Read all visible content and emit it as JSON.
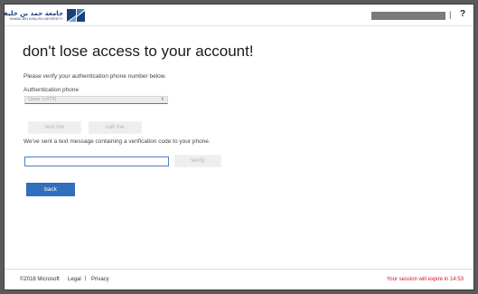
{
  "header": {
    "logo": {
      "arabic_name": "جامعة حمد بن خليفة",
      "english_name": "HAMAD BIN KHALIFA UNIVERSITY",
      "brand_color": "#1b3f7a"
    },
    "separator": "|",
    "help_label": "?"
  },
  "main": {
    "title": "don't lose access to your account!",
    "intro": "Please verify your authentication phone number below.",
    "phone_label": "Authentication phone",
    "phone_select_value": "Qatar (+974)",
    "text_me_label": "text me",
    "call_me_label": "call me",
    "sent_message": "We've sent a text message containing a verification code to your phone.",
    "verify_code_value": "",
    "verify_label": "verify",
    "back_label": "back",
    "accent_color": "#2f6fbd"
  },
  "footer": {
    "copyright": "©2018 Microsoft",
    "legal": "Legal",
    "separator": "|",
    "privacy": "Privacy",
    "session": "Your session will expire in 14:53",
    "session_color": "#d1182b"
  }
}
